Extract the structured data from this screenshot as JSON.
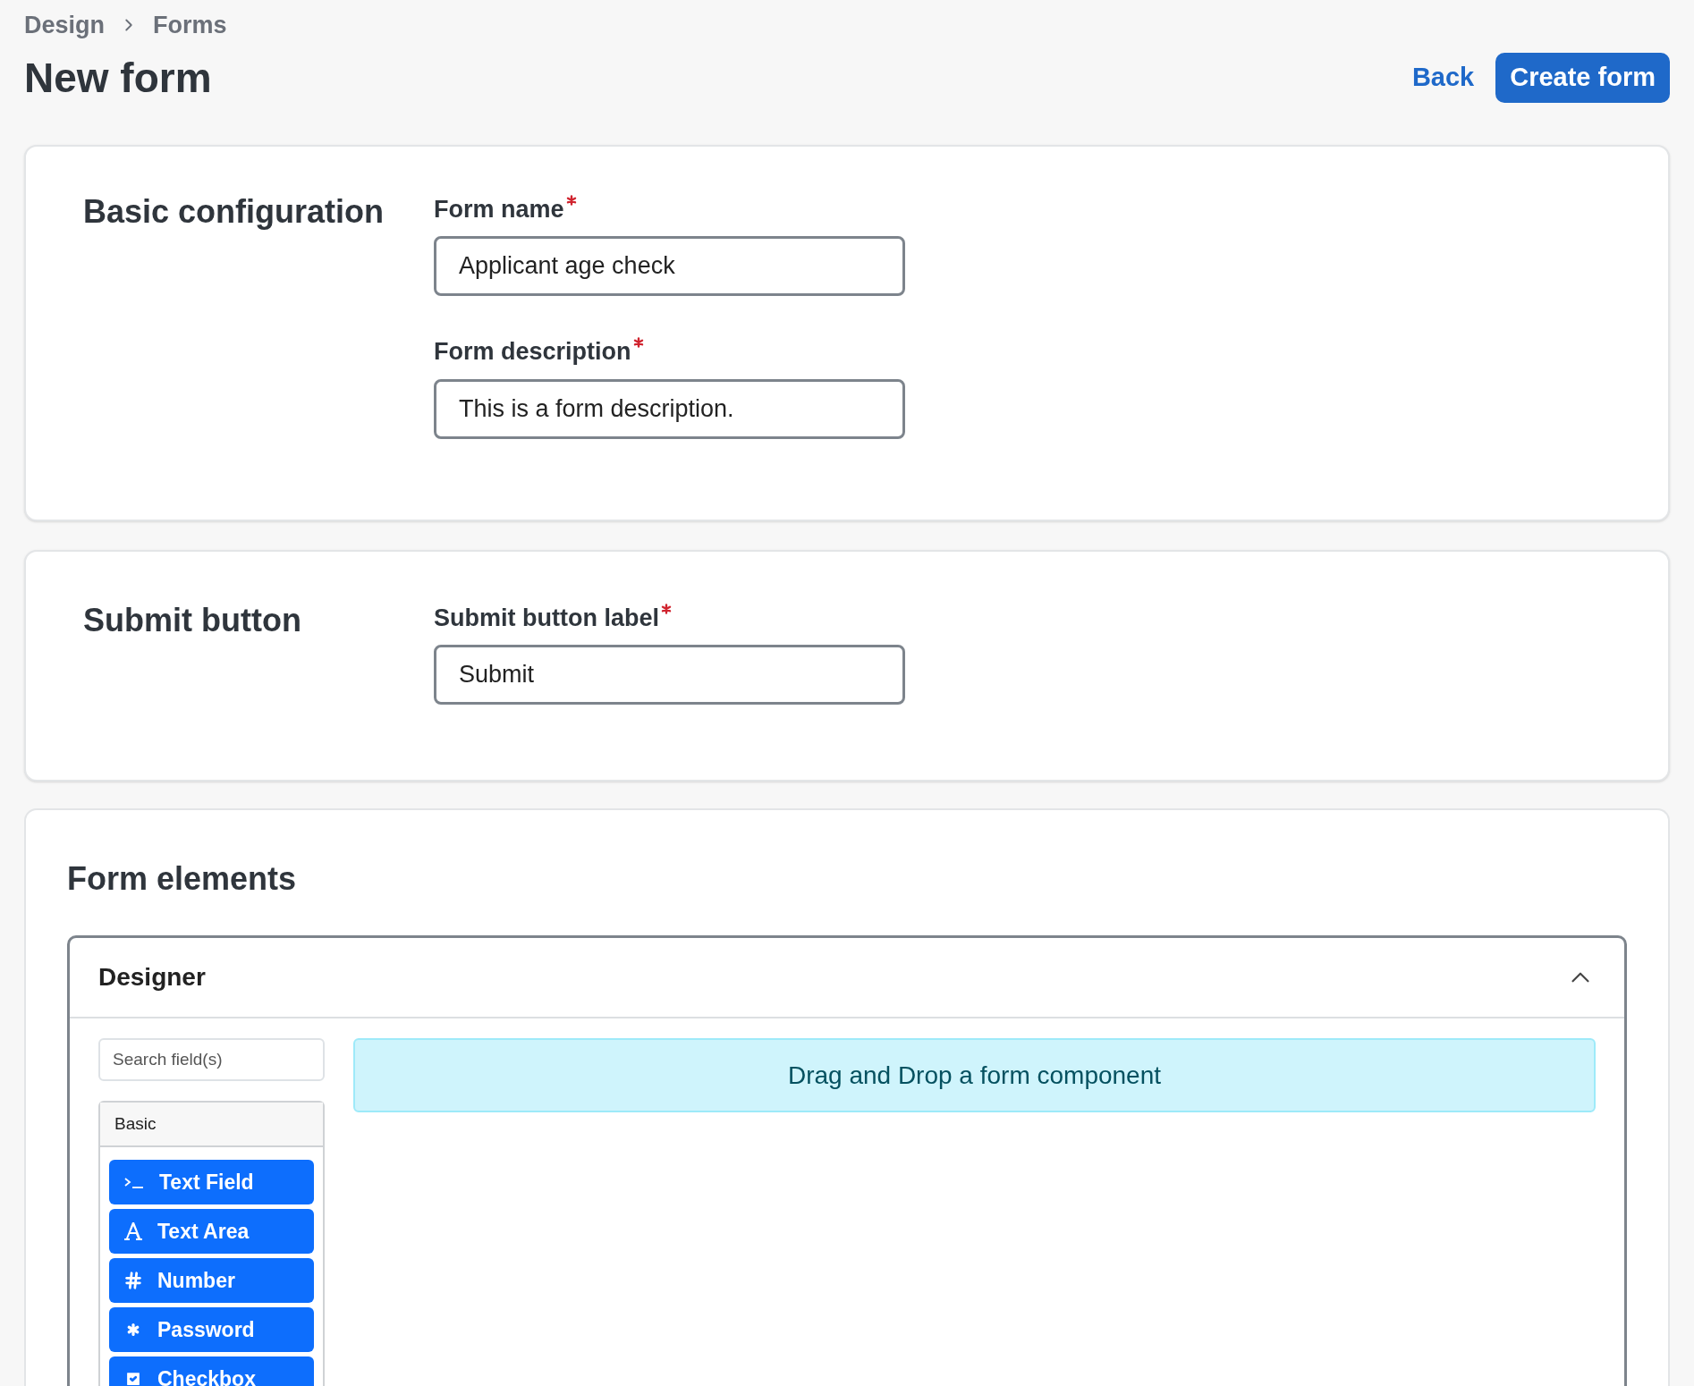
{
  "breadcrumb": [
    "Design",
    "Forms"
  ],
  "title": "New form",
  "actions": {
    "back": "Back",
    "create": "Create form"
  },
  "sections": [
    {
      "heading": "Basic configuration",
      "fields": [
        {
          "label": "Form name",
          "required": true,
          "value": "Applicant age check"
        },
        {
          "label": "Form description",
          "required": true,
          "value": "This is a form description."
        }
      ]
    },
    {
      "heading": "Submit button",
      "fields": [
        {
          "label": "Submit button label",
          "required": true,
          "value": "Submit"
        }
      ]
    }
  ],
  "form_elements": {
    "heading": "Form elements",
    "designer": {
      "title": "Designer",
      "expanded": true,
      "search": {
        "placeholder": "Search field(s)"
      },
      "group": "Basic",
      "components": [
        {
          "kind": "textfield",
          "label": "Text Field"
        },
        {
          "kind": "textarea",
          "label": "Text Area"
        },
        {
          "kind": "number",
          "label": "Number"
        },
        {
          "kind": "password",
          "label": "Password"
        },
        {
          "kind": "checkbox",
          "label": "Checkbox"
        }
      ],
      "dropzone": "Drag and Drop a form component"
    }
  }
}
